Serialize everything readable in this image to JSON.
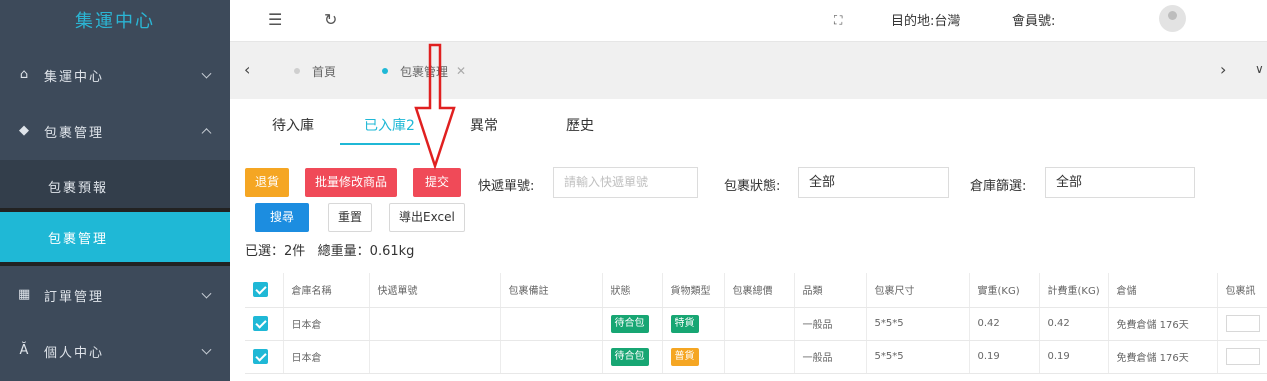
{
  "sidebar": {
    "logo": "集運中心",
    "items": [
      {
        "label": "集運中心",
        "icon": "home-icon"
      },
      {
        "label": "包裹管理",
        "icon": "package-icon"
      },
      {
        "label": "訂單管理",
        "icon": "order-icon"
      },
      {
        "label": "個人中心",
        "icon": "user-icon"
      }
    ],
    "subitems": [
      {
        "label": "包裹預報"
      },
      {
        "label": "包裹管理"
      }
    ]
  },
  "header": {
    "destination": "目的地:台灣",
    "member": "會員號:"
  },
  "tags": [
    {
      "label": "首頁"
    },
    {
      "label": "包裹管理"
    }
  ],
  "tabs": [
    "待入庫",
    "已入庫2",
    "異常",
    "歷史"
  ],
  "toolbar": {
    "return_label": "退貨",
    "batch_edit_label": "批量修改商品",
    "submit_label": "提交",
    "search_label": "搜尋",
    "reset_label": "重置",
    "export_label": "導出Excel"
  },
  "filters": {
    "tracking_label": "快遞單號:",
    "tracking_placeholder": "請輸入快遞單號",
    "status_label": "包裹狀態:",
    "status_value": "全部",
    "warehouse_label": "倉庫篩選:",
    "warehouse_value": "全部"
  },
  "summary": "已選：2件   總重量：0.61kg",
  "table": {
    "headers": [
      "倉庫名稱",
      "快遞單號",
      "包裹備註",
      "狀態",
      "貨物類型",
      "包裹總價",
      "品類",
      "包裹尺寸",
      "實重(KG)",
      "計費重(KG)",
      "倉儲",
      "包裹訊"
    ],
    "rows": [
      {
        "warehouse": "日本倉",
        "tracking": "",
        "note": "",
        "status": "待合包",
        "cargo": "特貨",
        "price": "",
        "category": "一般品",
        "size": "5*5*5",
        "actual": "0.42",
        "billed": "0.42",
        "storage": "免費倉儲 176天"
      },
      {
        "warehouse": "日本倉",
        "tracking": "",
        "note": "",
        "status": "待合包",
        "cargo": "普貨",
        "price": "",
        "category": "一般品",
        "size": "5*5*5",
        "actual": "0.19",
        "billed": "0.19",
        "storage": "免費倉儲 176天"
      }
    ]
  },
  "colors": {
    "accent": "#1fb8d6",
    "sidebar_bg": "#3d4a5a",
    "status_badge": "#17a673",
    "cargo_special": "#17a673",
    "cargo_normal": "#f5a623",
    "annotation": "#e02020"
  }
}
